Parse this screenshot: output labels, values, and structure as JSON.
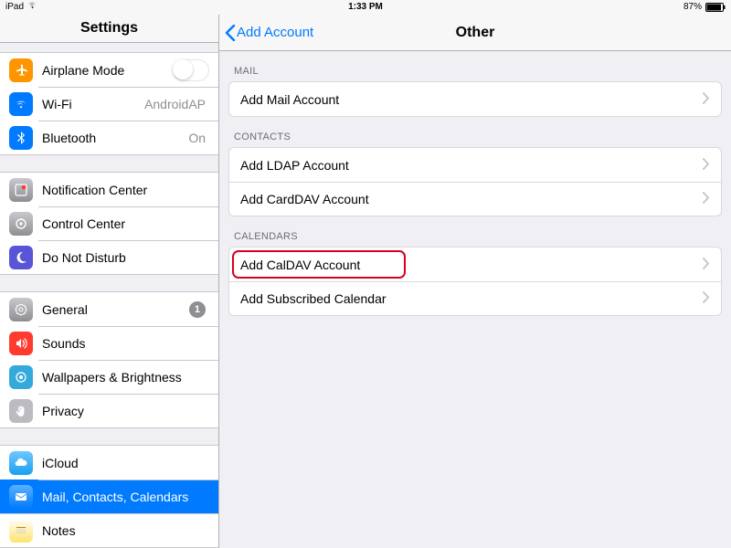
{
  "statusbar": {
    "device": "iPad",
    "time": "1:33 PM",
    "battery_pct": "87%"
  },
  "sidebar": {
    "title": "Settings",
    "groups": [
      [
        {
          "icon": "airplane-icon",
          "bg": "bg-orange",
          "label": "Airplane Mode",
          "trailing": "switch"
        },
        {
          "icon": "wifi-icon",
          "bg": "bg-blue",
          "label": "Wi-Fi",
          "value": "AndroidAP"
        },
        {
          "icon": "bluetooth-icon",
          "bg": "bg-blue",
          "label": "Bluetooth",
          "value": "On"
        }
      ],
      [
        {
          "icon": "notification-icon",
          "bg": "bg-grad-gray",
          "label": "Notification Center"
        },
        {
          "icon": "control-center-icon",
          "bg": "bg-grad-gray",
          "label": "Control Center"
        },
        {
          "icon": "moon-icon",
          "bg": "bg-purple",
          "label": "Do Not Disturb"
        }
      ],
      [
        {
          "icon": "gear-icon",
          "bg": "bg-grad-gray",
          "label": "General",
          "badge": "1"
        },
        {
          "icon": "speaker-icon",
          "bg": "bg-red",
          "label": "Sounds"
        },
        {
          "icon": "wallpaper-icon",
          "bg": "bg-cyan",
          "label": "Wallpapers & Brightness"
        },
        {
          "icon": "hand-icon",
          "bg": "bg-hand",
          "label": "Privacy"
        }
      ],
      [
        {
          "icon": "icloud-icon",
          "bg": "bg-icloud",
          "label": "iCloud"
        },
        {
          "icon": "mail-icon",
          "bg": "bg-mail",
          "label": "Mail, Contacts, Calendars",
          "selected": true
        },
        {
          "icon": "notes-icon",
          "bg": "bg-notes",
          "label": "Notes"
        }
      ]
    ]
  },
  "detail": {
    "back_label": "Add Account",
    "title": "Other",
    "sections": [
      {
        "header": "MAIL",
        "rows": [
          {
            "label": "Add Mail Account"
          }
        ]
      },
      {
        "header": "CONTACTS",
        "rows": [
          {
            "label": "Add LDAP Account"
          },
          {
            "label": "Add CardDAV Account"
          }
        ]
      },
      {
        "header": "CALENDARS",
        "rows": [
          {
            "label": "Add CalDAV Account",
            "highlight": true
          },
          {
            "label": "Add Subscribed Calendar"
          }
        ]
      }
    ]
  }
}
